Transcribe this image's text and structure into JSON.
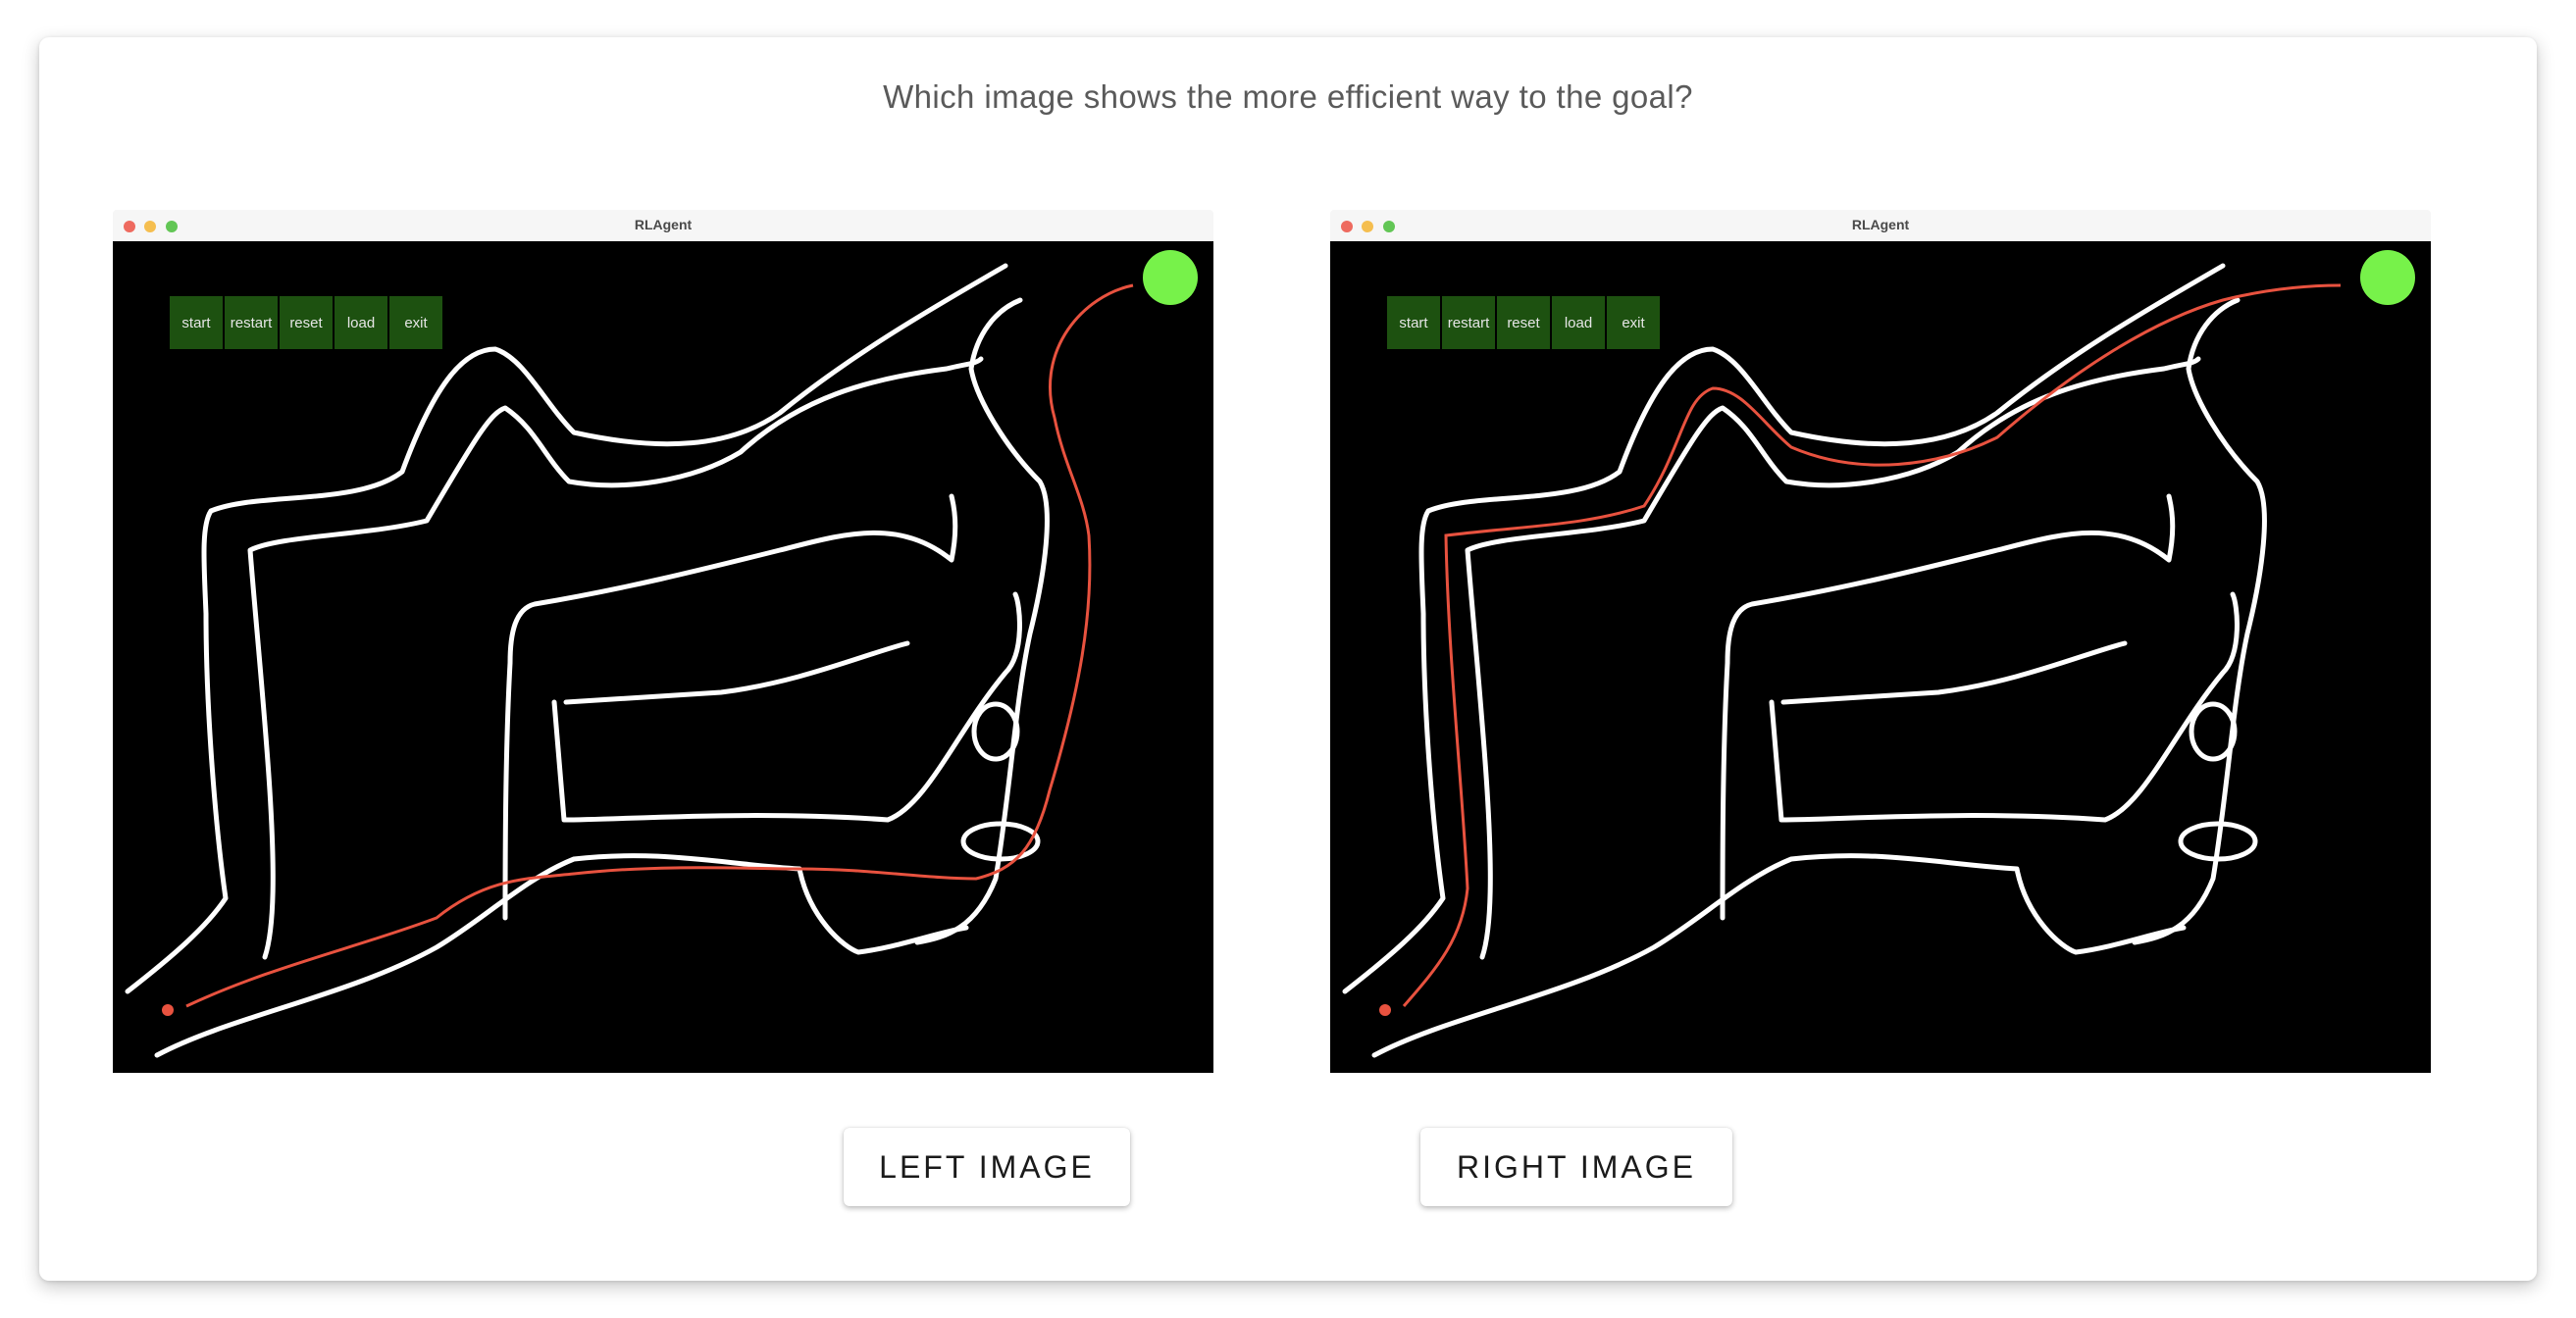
{
  "question": "Which image shows the more efficient way to the goal?",
  "panels": [
    {
      "window_title": "RLAgent",
      "toolbar": [
        "start",
        "restart",
        "reset",
        "load",
        "exit"
      ],
      "path_type": "long-lower-route",
      "goal_color": "#77f24a",
      "path_color": "#e8523f"
    },
    {
      "window_title": "RLAgent",
      "toolbar": [
        "start",
        "restart",
        "reset",
        "load",
        "exit"
      ],
      "path_type": "short-upper-route",
      "goal_color": "#77f24a",
      "path_color": "#e8523f"
    }
  ],
  "buttons": {
    "left_label": "LEFT IMAGE",
    "right_label": "RIGHT IMAGE"
  }
}
